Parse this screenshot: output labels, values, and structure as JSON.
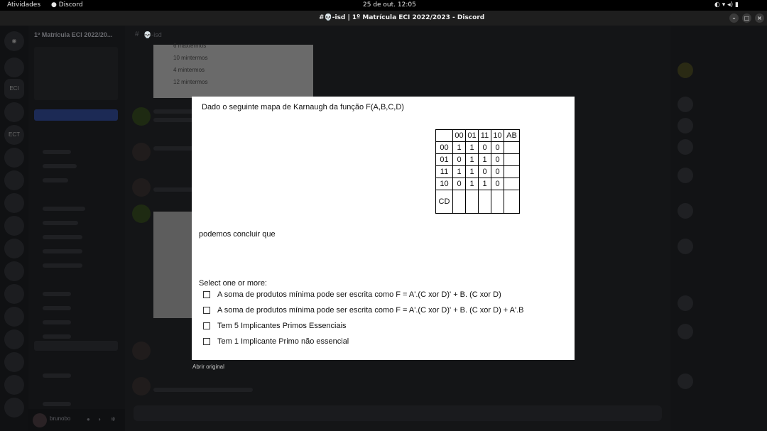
{
  "system_bar": {
    "activities": "Atividades",
    "app": "Discord",
    "clock": "25 de out. 12:05"
  },
  "window": {
    "title": "#💀-isd | 1º Matrícula ECI 2022/2023 - Discord"
  },
  "sidebar": {
    "server_name": "1º Matrícula ECI 2022/20...",
    "user": "brunobo"
  },
  "channel": {
    "name": "💀-isd"
  },
  "background_snippet": {
    "items": [
      "6 maxtermos",
      "10 mintermos",
      "4 mintermos",
      "12 mintermos"
    ]
  },
  "modal": {
    "prompt": "Dado o seguinte mapa de Karnaugh da função F(A,B,C,D)",
    "conclude": "podemos concluir que",
    "select": "Select one or more:",
    "kmap": {
      "col_headers": [
        "00",
        "01",
        "11",
        "10"
      ],
      "corner_right": "AB",
      "row_headers": [
        "00",
        "01",
        "11",
        "10"
      ],
      "rows": [
        [
          "1",
          "1",
          "0",
          "0"
        ],
        [
          "0",
          "1",
          "1",
          "0"
        ],
        [
          "1",
          "1",
          "0",
          "0"
        ],
        [
          "0",
          "1",
          "1",
          "0"
        ]
      ],
      "corner_bottom": "CD"
    },
    "options": [
      "A soma de produtos mínima pode ser escrita como  F = A'.(C xor D)' + B. (C xor D)",
      "A soma de produtos mínima pode ser escrita como  F = A'.(C xor D)' + B. (C xor D) + A'.B",
      "Tem 5 Implicantes Primos Essenciais",
      "Tem 1 Implicante Primo não essencial"
    ]
  },
  "open_original": "Abrir original"
}
